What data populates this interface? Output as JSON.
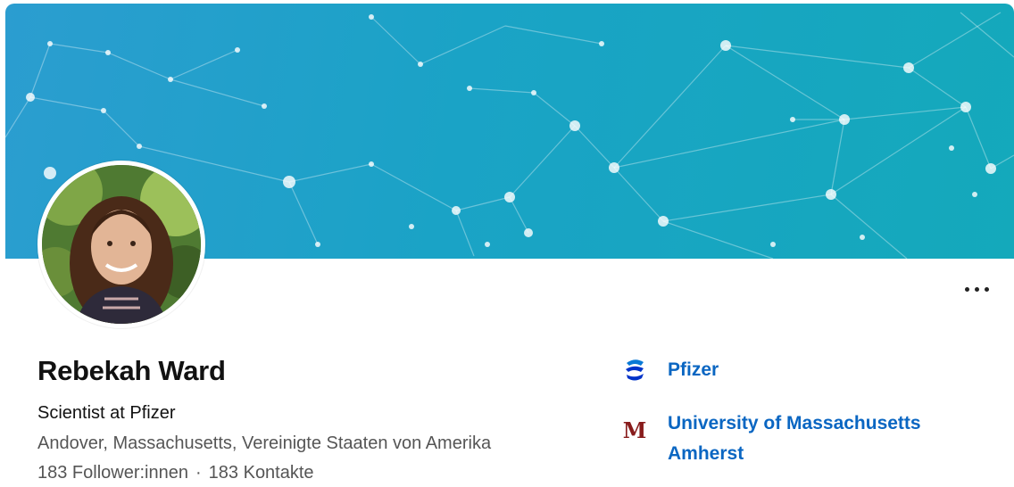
{
  "profile": {
    "name": "Rebekah Ward",
    "headline": "Scientist at Pfizer",
    "location": "Andover, Massachusetts, Vereinigte Staaten von Amerika",
    "followers": "183 Follower:innen",
    "separator": "·",
    "connections": "183 Kontakte"
  },
  "organizations": [
    {
      "label": "Pfizer",
      "icon": "pfizer-logo-icon"
    },
    {
      "label": "University of Massachusetts Amherst",
      "icon": "umass-logo-icon"
    }
  ],
  "logo_text": {
    "umass": "M"
  },
  "actions": {
    "more_icon": "more-options-icon"
  },
  "colors": {
    "link": "#0a66c2",
    "banner_start": "#2b9dd0",
    "banner_end": "#14a9bb",
    "umass": "#881c1c",
    "pfizer": "#0033c9"
  }
}
